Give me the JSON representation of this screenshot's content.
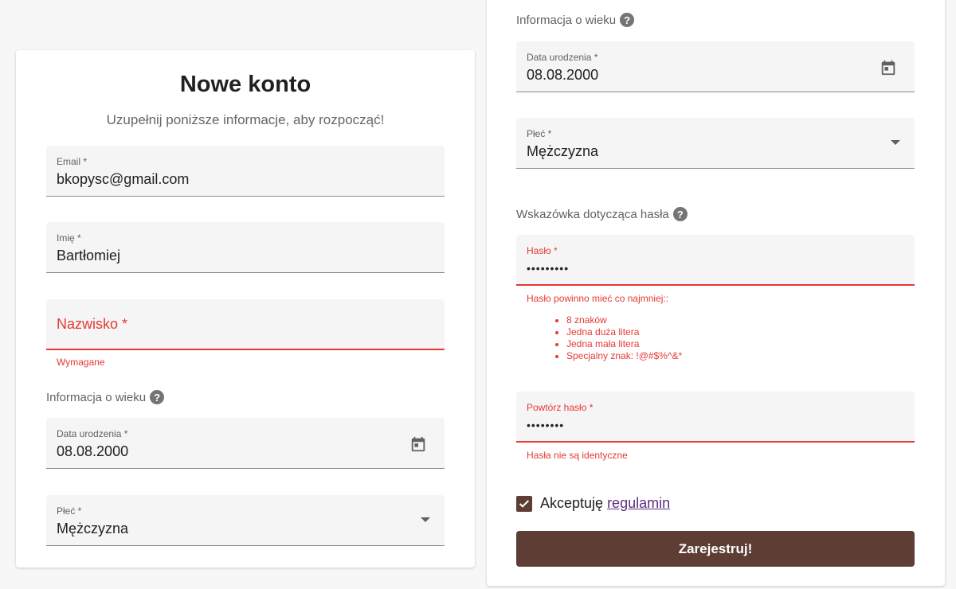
{
  "left": {
    "title": "Nowe konto",
    "subtitle": "Uzupełnij poniższe informacje, aby rozpocząć!",
    "email": {
      "label": "Email *",
      "value": "bkopysc@gmail.com"
    },
    "first_name": {
      "label": "Imię *",
      "value": "Bartłomiej"
    },
    "last_name": {
      "label": "Nazwisko *",
      "error": "Wymagane"
    },
    "age_section": "Informacja o wieku",
    "birth_date": {
      "label": "Data urodzenia *",
      "value": "08.08.2000"
    },
    "gender": {
      "label": "Płeć *",
      "value": "Mężczyzna"
    }
  },
  "right": {
    "age_section": "Informacja o wieku",
    "birth_date": {
      "label": "Data urodzenia *",
      "value": "08.08.2000"
    },
    "gender": {
      "label": "Płeć *",
      "value": "Mężczyzna"
    },
    "password_hint_section": "Wskazówka dotycząca hasła",
    "password": {
      "label": "Hasło *",
      "value": "•••••••••",
      "error": "Hasło powinno mieć co najmniej::"
    },
    "requirements": [
      "8 znaków",
      "Jedna duża litera",
      "Jedna mała litera",
      "Specjalny znak: !@#$%^&*"
    ],
    "repeat_password": {
      "label": "Powtórz hasło *",
      "value": "••••••••",
      "error": "Hasła nie są identyczne"
    },
    "accept_text": "Akceptuję",
    "terms_link": "regulamin",
    "submit": "Zarejestruj!"
  },
  "icons": {
    "help": "?",
    "calendar": "calendar-icon",
    "dropdown": "caret-down-icon",
    "check": "check-icon"
  },
  "colors": {
    "brand": "#5d3d34",
    "error": "#e53935",
    "link": "#5b2c83"
  }
}
